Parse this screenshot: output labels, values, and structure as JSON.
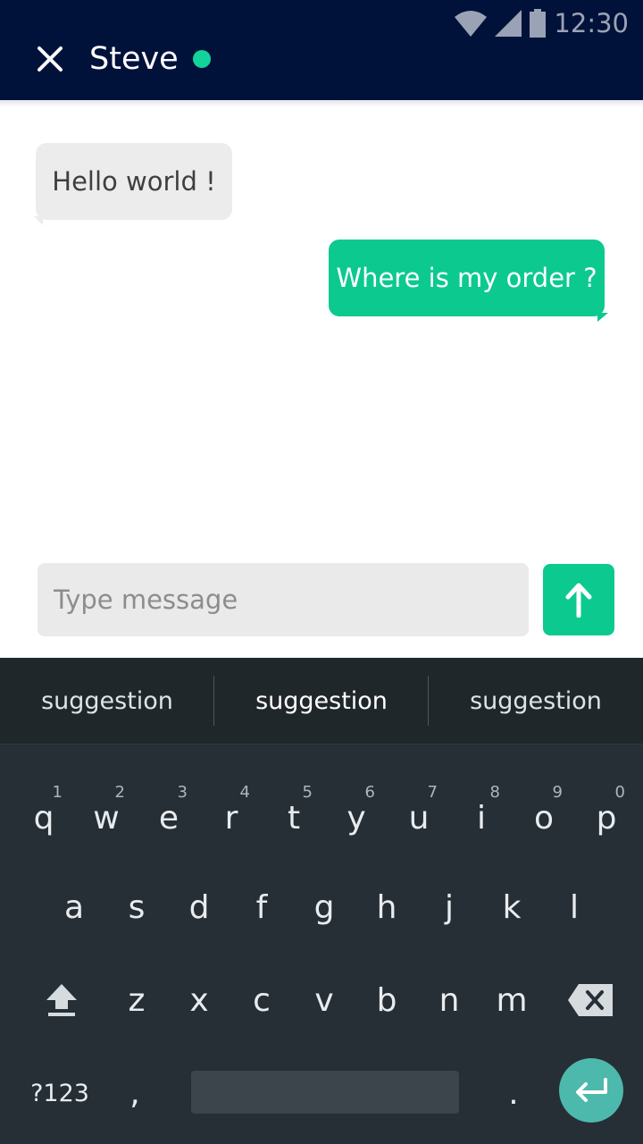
{
  "status_bar": {
    "time": "12:30"
  },
  "header": {
    "contact_name": "Steve"
  },
  "messages": [
    {
      "direction": "incoming",
      "text": "Hello world !"
    },
    {
      "direction": "outgoing",
      "text": "Where is my order ?"
    }
  ],
  "composer": {
    "placeholder": "Type message"
  },
  "keyboard": {
    "suggestions": [
      "suggestion",
      "suggestion",
      "suggestion"
    ],
    "row1": [
      "q",
      "w",
      "e",
      "r",
      "t",
      "y",
      "u",
      "i",
      "o",
      "p"
    ],
    "row1_hints": [
      "1",
      "2",
      "3",
      "4",
      "5",
      "6",
      "7",
      "8",
      "9",
      "0"
    ],
    "row2": [
      "a",
      "s",
      "d",
      "f",
      "g",
      "h",
      "j",
      "k",
      "l"
    ],
    "row3": [
      "z",
      "x",
      "c",
      "v",
      "b",
      "n",
      "m"
    ],
    "symbols_label": "?123",
    "comma": ",",
    "period": "."
  },
  "colors": {
    "header": "#00113a",
    "accent": "#0cc98f",
    "online": "#12d39a",
    "keyboard": "#262f35",
    "enter": "#4db8ac"
  }
}
